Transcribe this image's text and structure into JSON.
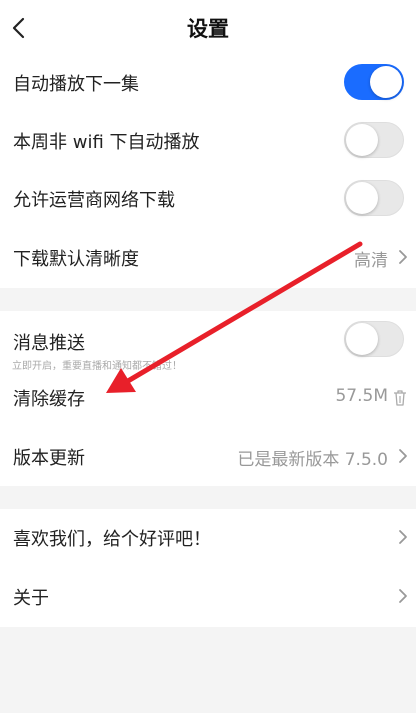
{
  "header": {
    "title": "设置"
  },
  "section1": {
    "autoplay_next": {
      "label": "自动播放下一集",
      "enabled": true
    },
    "wifi_autoplay": {
      "label": "本周非 wifi 下自动播放",
      "enabled": false
    },
    "carrier_download": {
      "label": "允许运营商网络下载",
      "enabled": false
    },
    "download_quality": {
      "label": "下载默认清晰度",
      "value": "高清"
    }
  },
  "section2": {
    "push": {
      "label": "消息推送",
      "subtitle": "立即开启，重要直播和通知都不错过！",
      "enabled": false
    },
    "cache": {
      "label": "清除缓存",
      "value": "57.5M"
    },
    "version": {
      "label": "版本更新",
      "value": "已是最新版本 7.5.0"
    }
  },
  "section3": {
    "rate": {
      "label": "喜欢我们，给个好评吧！"
    },
    "about": {
      "label": "关于"
    }
  },
  "colors": {
    "accent": "#1a6cff",
    "annotation": "#e8202a"
  }
}
